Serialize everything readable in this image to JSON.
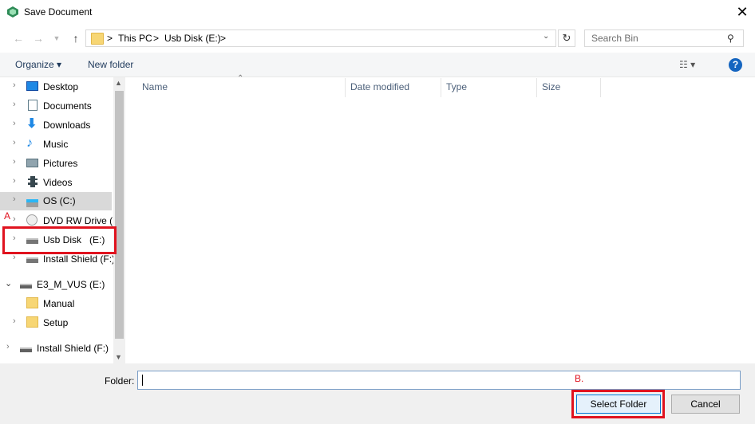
{
  "window": {
    "title": "Save Document"
  },
  "address": {
    "crumbs": [
      "This PC",
      "Usb Disk (E:)"
    ],
    "separator": ">"
  },
  "search": {
    "placeholder": "Search Bin"
  },
  "toolbar": {
    "organize": "Organize ▾",
    "new_folder": "New folder",
    "help": "?"
  },
  "tree": {
    "items": [
      {
        "label": "Desktop",
        "icon": "desktop-icon"
      },
      {
        "label": "Documents",
        "icon": "documents-icon"
      },
      {
        "label": "Downloads",
        "icon": "downloads-icon"
      },
      {
        "label": "Music",
        "icon": "music-icon"
      },
      {
        "label": "Pictures",
        "icon": "pictures-icon"
      },
      {
        "label": "Videos",
        "icon": "videos-icon"
      },
      {
        "label": "OS (C:)",
        "icon": "windows-drive-icon"
      },
      {
        "label": "DVD RW Drive (D",
        "icon": "dvd-drive-icon"
      },
      {
        "label": "Usb Disk   (E:)",
        "icon": "usb-drive-icon"
      },
      {
        "label": "Install Shield (F:)",
        "icon": "usb-drive-icon"
      },
      {
        "label": "E3_M_VUS (E:)",
        "icon": "drive-icon"
      },
      {
        "label": "Manual",
        "icon": "folder-icon"
      },
      {
        "label": "Setup",
        "icon": "folder-icon"
      },
      {
        "label": "Install Shield (F:)",
        "icon": "drive-icon"
      }
    ]
  },
  "columns": [
    "Name",
    "Date modified",
    "Type",
    "Size"
  ],
  "footer": {
    "folder_label": "Folder:",
    "folder_value": "",
    "select_button": "Select Folder",
    "cancel_button": "Cancel"
  },
  "annotations": {
    "marker_a": "A",
    "marker_b": "B."
  },
  "colors": {
    "accent": "#0078d7",
    "annotation": "#e0131f"
  }
}
